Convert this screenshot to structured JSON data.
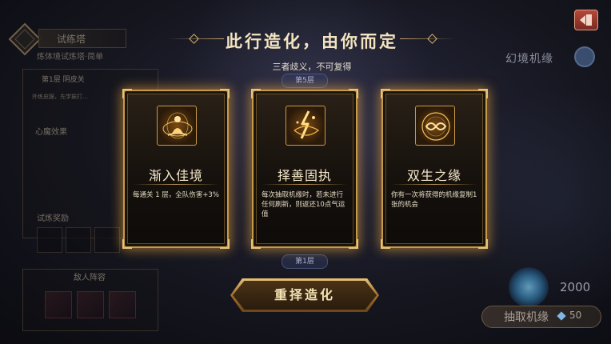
{
  "left_panel": {
    "tower_title": "试练塔",
    "tower_subtitle": "炼体境试炼塔·简单",
    "floor_header": "第1层 阴皮关",
    "floor_desc": "外练皮膜，先学挨打…",
    "demon_effect_label": "心魔效果",
    "trial_reward_label": "试炼奖励",
    "enemy_lineup_label": "敌人阵容"
  },
  "header": {
    "title": "此行造化，由你而定",
    "subtitle": "三者歧义，不可复得",
    "floor_marker_top": "第5层",
    "floor_marker_bottom": "第1层"
  },
  "cards": [
    {
      "icon": "meditation-icon",
      "title": "渐入佳境",
      "desc": "每通关 1 层，全队伤害+3%"
    },
    {
      "icon": "lightning-swirl-icon",
      "title": "择善固执",
      "desc": "每次抽取机缘时，若未进行任何刷新，则返还10点气运值"
    },
    {
      "icon": "infinity-orb-icon",
      "title": "双生之缘",
      "desc": "你有一次将获得的机缘复制1张的机会"
    }
  ],
  "reselect_label": "重择造化",
  "right_panel": {
    "realm_label": "幻境机缘",
    "orb_count": "2000",
    "draw_label": "抽取机缘",
    "draw_cost": "50"
  },
  "colors": {
    "accent_gold": "#c79a4a",
    "back_button_red": "#b4483a"
  }
}
